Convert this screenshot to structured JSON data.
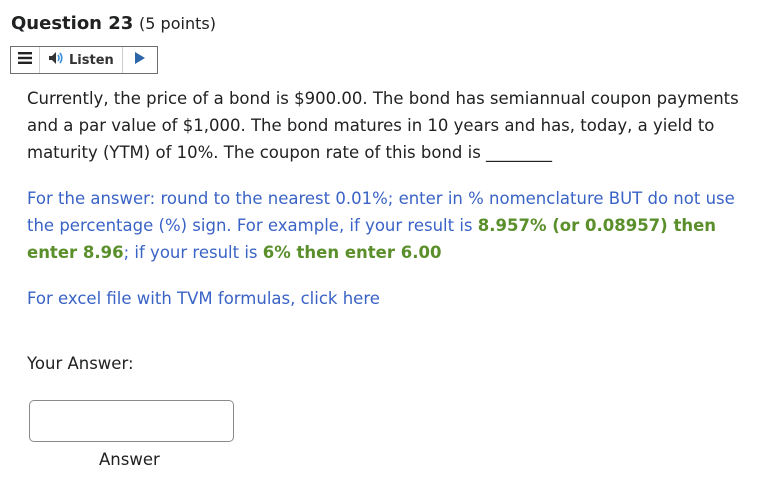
{
  "question": {
    "title_number": "Question 23",
    "title_points": "(5 points)"
  },
  "listen_toolbar": {
    "listen_label": "Listen",
    "menu_icon": "hamburger-menu-icon",
    "speaker_icon": "speaker-icon",
    "play_icon": "play-icon"
  },
  "body": {
    "stem": "Currently, the price of a bond is $900.00.  The bond has semiannual coupon payments and a par value of $1,000. The bond matures in 10 years and has, today, a yield to maturity (YTM) of 10%. The coupon rate of this bond is ________",
    "hint_part1": "For the answer: round to the nearest 0.01%; enter in % nomenclature BUT do not use the percentage (%) sign. For example, if your result is ",
    "hint_green1": "8.957% (or 0.08957) then enter 8.96",
    "hint_part2": "; if your result is ",
    "hint_green2": "6% then enter 6.00",
    "excel_link": "For excel file with TVM formulas, click here"
  },
  "answer": {
    "label": "Your Answer:",
    "value": "",
    "caption": "Answer"
  },
  "colors": {
    "link_blue": "#3a63c6",
    "green": "#5a8f2b",
    "text": "#202122"
  }
}
